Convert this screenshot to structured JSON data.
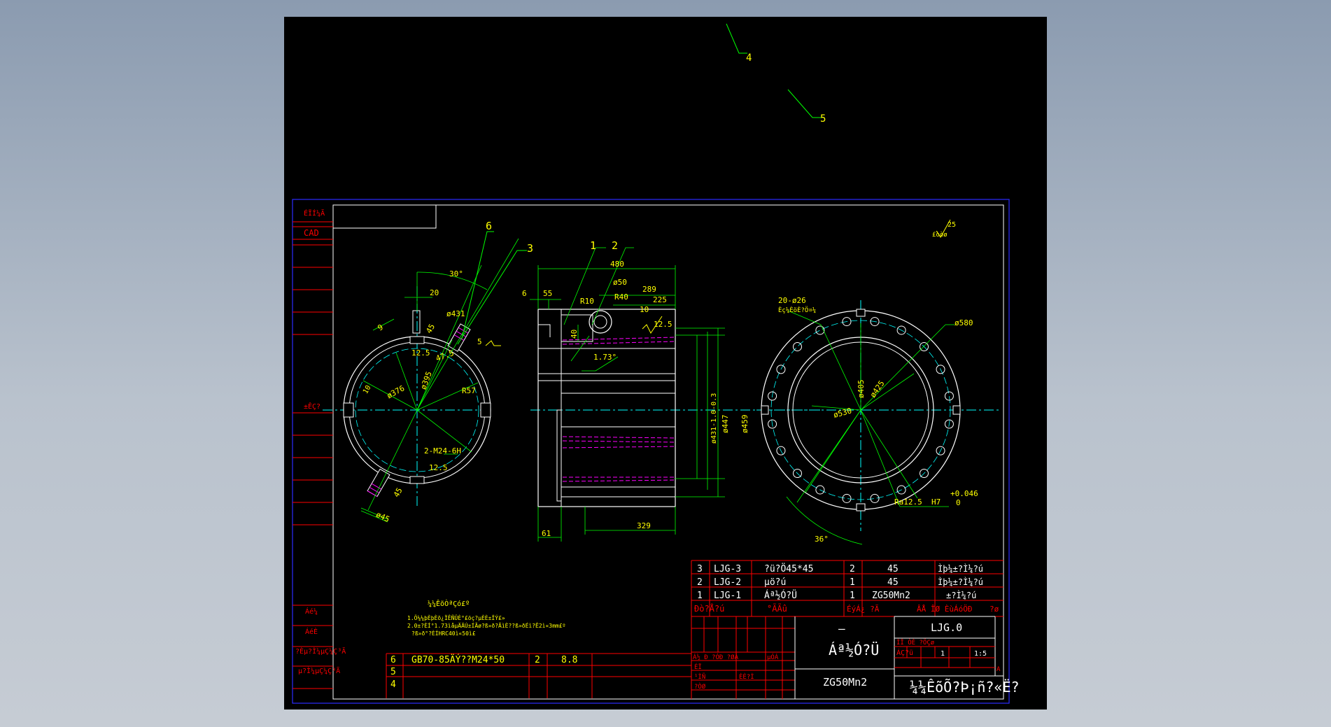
{
  "colors": {
    "background": "#000000",
    "frame": "#ffffff",
    "border_blue": "#2b2bff",
    "dimension": "#00ff00",
    "text": "#ffff00",
    "table_red": "#ff0000",
    "hatch_magenta": "#ff00ff",
    "centerline_cyan": "#00ffff"
  },
  "leaders": {
    "n4": "4",
    "n5": "5",
    "n6": "6",
    "n3": "3",
    "n1": "1",
    "n2": "2"
  },
  "left_strip": {
    "top1": "ÉÏÍ¼Ã",
    "cad": "CAD",
    "mid": "±ÊÇ?",
    "b1": "Áé¼",
    "b2": "ÁéÈ",
    "b3": "?Èµ?Ì¼µÇ¼Ç³Ã",
    "b4": "µ?Ì¼µÇ¼Ç³Ã"
  },
  "roughness": {
    "value": "25",
    "label": "£òòø"
  },
  "left_view": {
    "angle30": "30°",
    "d20": "20",
    "d431": "ø431",
    "a45a": "45",
    "d9": "9",
    "d12_5a": "12.5",
    "d5": "5",
    "d47_5": "47.5",
    "d376": "ø376",
    "d395": "ø395",
    "r57": "R57",
    "n10": "10",
    "thread": "2-M24-6H",
    "d12_5b": "12.5",
    "a45b": "45",
    "d45": "ø45",
    "a45c": "45"
  },
  "middle_view": {
    "d480": "480",
    "d6": "6",
    "d55": "55",
    "d50": "ø50",
    "d289": "289",
    "r10": "R10",
    "r40": "R40",
    "d225": "225",
    "d10": "10",
    "d12_5": "12.5",
    "d40": "40",
    "a1_73": "1.73°",
    "d431": "ø431-1.0-0.3",
    "d447": "ø447",
    "d459": "ø459",
    "d329": "329",
    "d61": "61"
  },
  "right_view": {
    "holes": "20-ø26",
    "holes_note": "Èç¼ÈöÈ?Ö¤¼",
    "d580": "ø580",
    "d405": "ø405",
    "d425": "ø425",
    "d530": "ø530",
    "ra": "Ra12.5",
    "fit": "H7",
    "tol_up": "+0.046",
    "tol_lo": "0",
    "angle36": "36°"
  },
  "notes": {
    "title": "¼¼ÊõÒªÇó£º",
    "line1": "1.Ö¼¼þÈþÈõ¿ÏÊÑÜÈ°£öç?µÈÈ±ÏÝ£»",
    "line2": "2.0±?ÈÍ°1.73ìåµÄÄÚ±ÍÃø?ß»ð?ÃìÈ??ß»ðÉì?Ê2ì«3mm£º",
    "line3": "?ß»ð°?ÈÍHRC40ì«50ì£"
  },
  "small_table": {
    "rows": [
      {
        "n": "6",
        "code": "GB70-85ÄÝ??M24*50",
        "qty": "2",
        "mat": "8.8"
      },
      {
        "n": "5",
        "code": "",
        "qty": "",
        "mat": ""
      },
      {
        "n": "4",
        "code": "",
        "qty": "",
        "mat": ""
      }
    ]
  },
  "bom": {
    "rows": [
      {
        "n": "3",
        "code": "LJG-3",
        "name": "?ü?Ö45*45",
        "qty": "2",
        "mat": "45",
        "note": "Ìþ¼±?Ì¼?ú"
      },
      {
        "n": "2",
        "code": "LJG-2",
        "name": "µö?ú",
        "qty": "1",
        "mat": "45",
        "note": "Ìþ¼±?Ì¼?ú"
      },
      {
        "n": "1",
        "code": "LJG-1",
        "name": "Áª½Ó?Ü",
        "qty": "1",
        "mat": "ZG50Mn2",
        "note": "±?Ì¼?ú"
      }
    ],
    "header": {
      "n": "Ðò?Å?ú",
      "name": "°ÃÃû",
      "qty": "ÉýÁ¿ ?Ã",
      "mat": "ÂÅ ÎØ ÈùÁóÖÐ",
      "note": "?ø"
    }
  },
  "title_block": {
    "dash": "—",
    "part_name": "Áª½Ó?Ü",
    "material": "ZG50Mn2",
    "drawing_no": "LJG.0",
    "school": "¼¼ÊõÕ?Þ¡ñ?«Ë?",
    "scale": "1:5",
    "sheet": "A",
    "qty": "1",
    "small1": "ÌÎ ÒÈ ?ÖÇø",
    "small2": "ÁÇ?ü",
    "small3": "Á½ Ð ?ÓÐ ?ØÁ",
    "small4": "ÉÏ",
    "small5": "¹ÌÑ",
    "small6": "?ÒØ",
    "small7": "ÈÈ?Ì",
    "small8": "µÓÁ"
  }
}
